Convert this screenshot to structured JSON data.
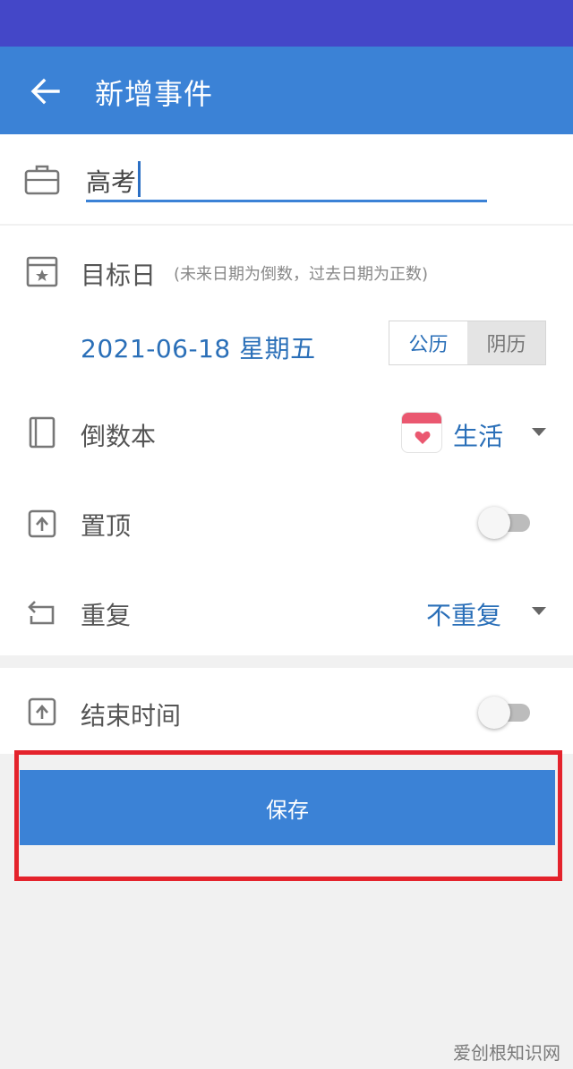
{
  "app_bar": {
    "title": "新增事件"
  },
  "event": {
    "name_value": "高考"
  },
  "target_date": {
    "label": "目标日",
    "hint": "(未来日期为倒数，过去日期为正数)",
    "date": "2021-06-18 星期五",
    "calendar_options": [
      "公历",
      "阴历"
    ],
    "selected_calendar": "公历"
  },
  "countdown_book": {
    "label": "倒数本",
    "value": "生活"
  },
  "pin_top": {
    "label": "置顶",
    "enabled": false
  },
  "repeat": {
    "label": "重复",
    "value": "不重复"
  },
  "end_time": {
    "label": "结束时间",
    "enabled": false
  },
  "save_button": {
    "label": "保存"
  },
  "watermark": "爱创根知识网",
  "colors": {
    "status_bar": "#4447c8",
    "app_bar": "#3b82d6",
    "accent_text": "#2a6fb8",
    "highlight_border": "#e4232c",
    "calendar_badge": "#ea5870"
  },
  "icons": {
    "back": "arrow-left-icon",
    "name": "briefcase-icon",
    "target_date": "calendar-star-icon",
    "countdown_book": "book-icon",
    "pin_top": "arrow-up-box-icon",
    "repeat": "repeat-arrow-icon",
    "end_time": "arrow-up-box-icon",
    "dropdown": "triangle-down-icon",
    "book_value": "calendar-heart-icon"
  }
}
